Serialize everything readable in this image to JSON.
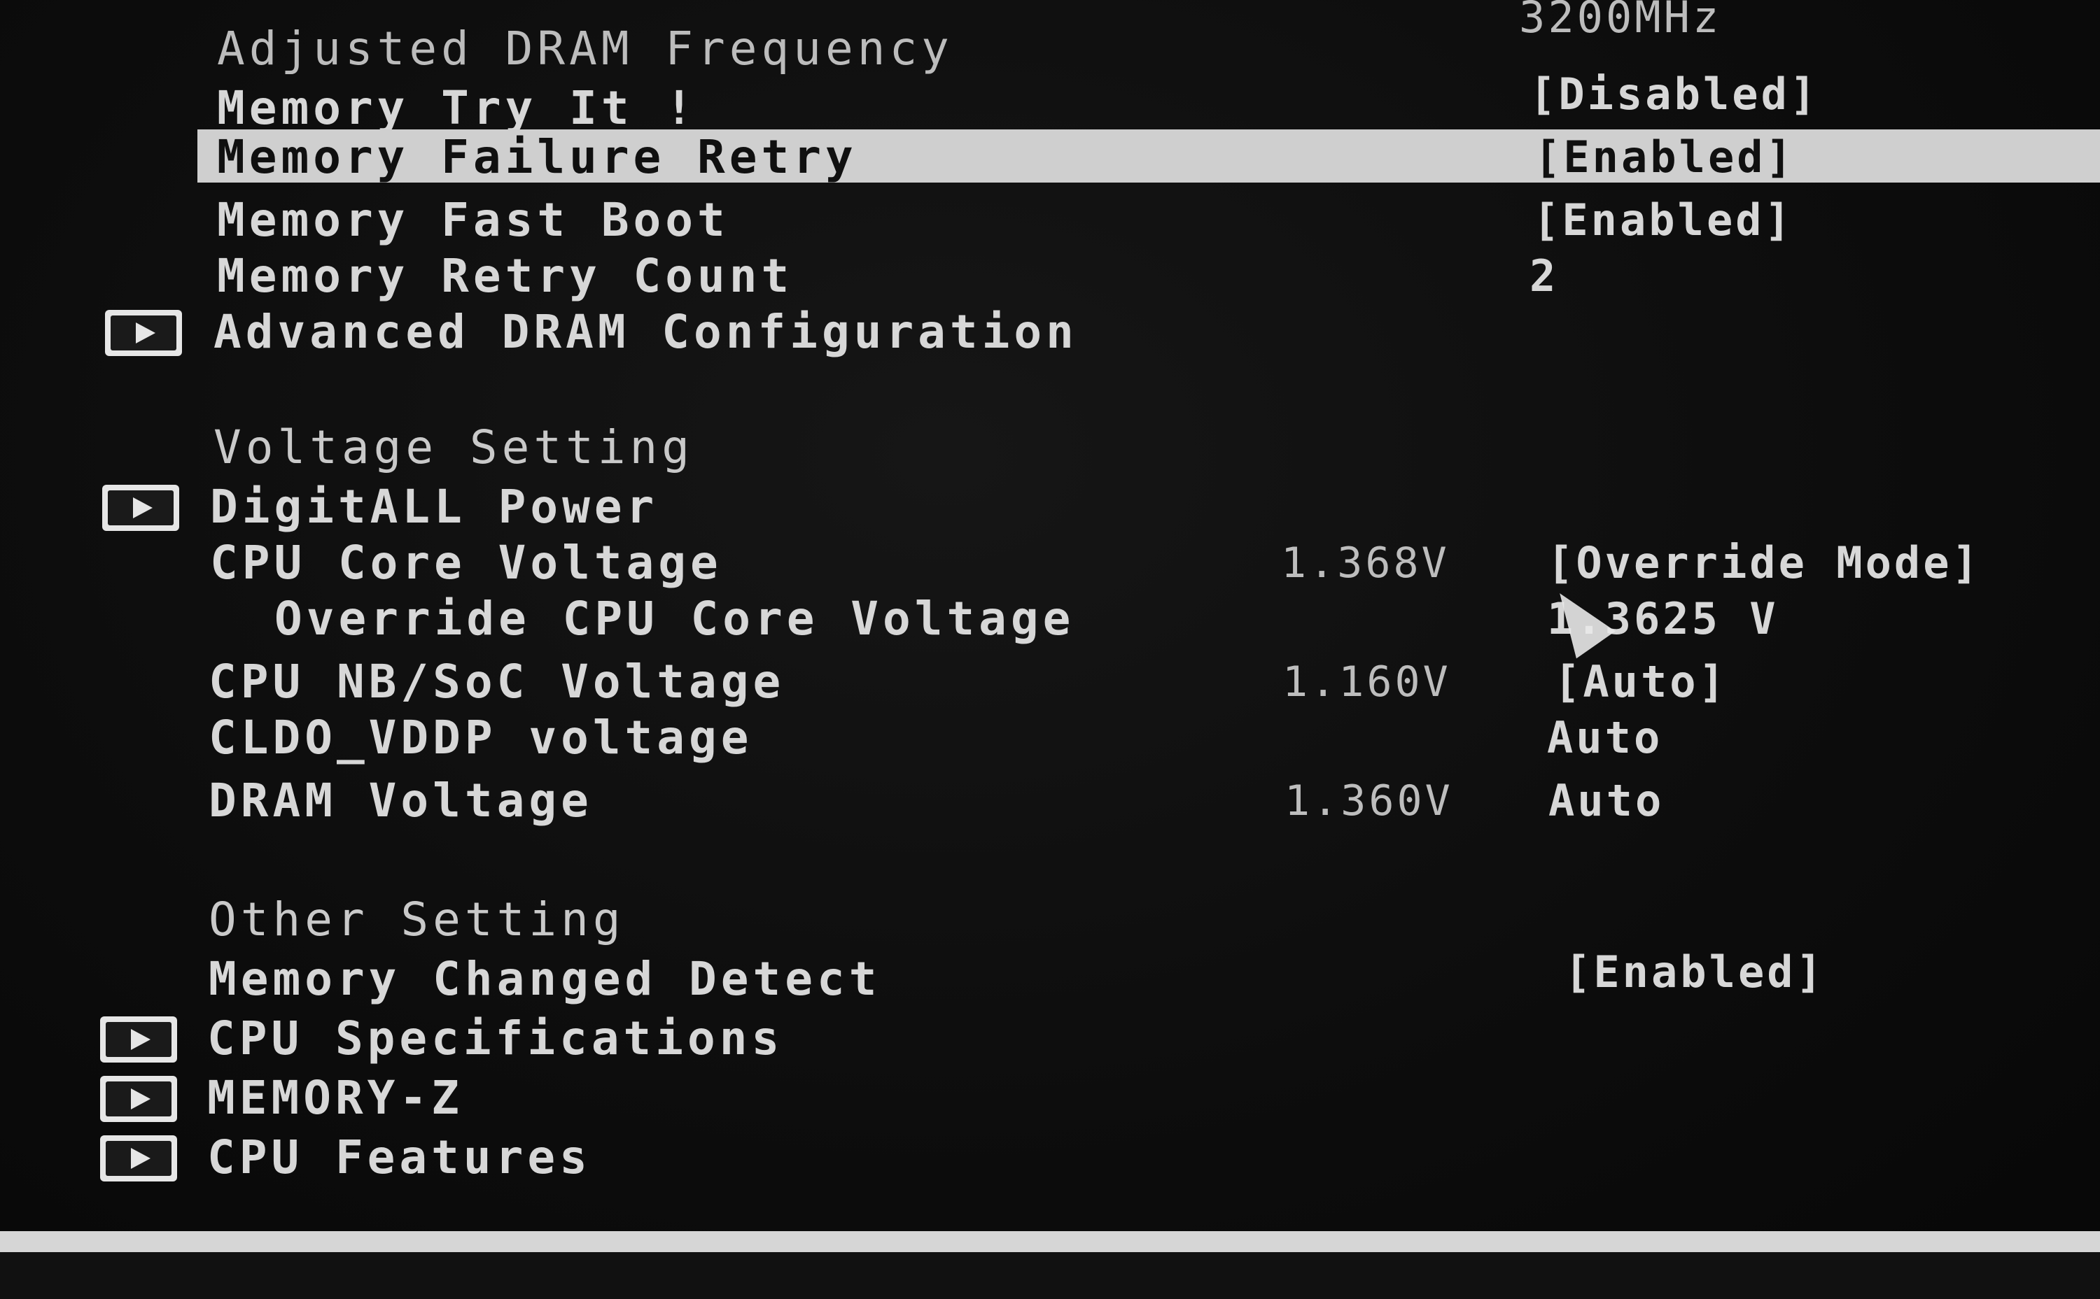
{
  "rows": [
    {
      "label": "Adjusted DRAM Frequency",
      "value": "3200MHz"
    },
    {
      "label": "Memory Try It !",
      "value": "[Disabled]"
    },
    {
      "label": "Memory Failure Retry",
      "value": "[Enabled]"
    },
    {
      "label": "Memory Fast Boot",
      "value": "[Enabled]"
    },
    {
      "label": "Memory Retry Count",
      "value": "2"
    },
    {
      "label": "Advanced DRAM Configuration"
    },
    {
      "label": "Voltage Setting"
    },
    {
      "label": "DigitALL Power"
    },
    {
      "label": "CPU Core Voltage",
      "reading": "1.368V",
      "value": "[Override Mode]"
    },
    {
      "label": "Override CPU Core Voltage",
      "value": "1.3625 V"
    },
    {
      "label": "CPU NB/SoC Voltage",
      "reading": "1.160V",
      "value": "[Auto]"
    },
    {
      "label": "CLDO_VDDP voltage",
      "value": "Auto"
    },
    {
      "label": "DRAM Voltage",
      "reading": "1.360V",
      "value": "Auto"
    },
    {
      "label": "Other Setting"
    },
    {
      "label": "Memory Changed Detect",
      "value": "[Enabled]"
    },
    {
      "label": "CPU Specifications"
    },
    {
      "label": "MEMORY-Z"
    },
    {
      "label": "CPU Features"
    }
  ],
  "icons": {
    "submenu": "submenu-arrow-icon",
    "cursor": "mouse-cursor-icon"
  }
}
